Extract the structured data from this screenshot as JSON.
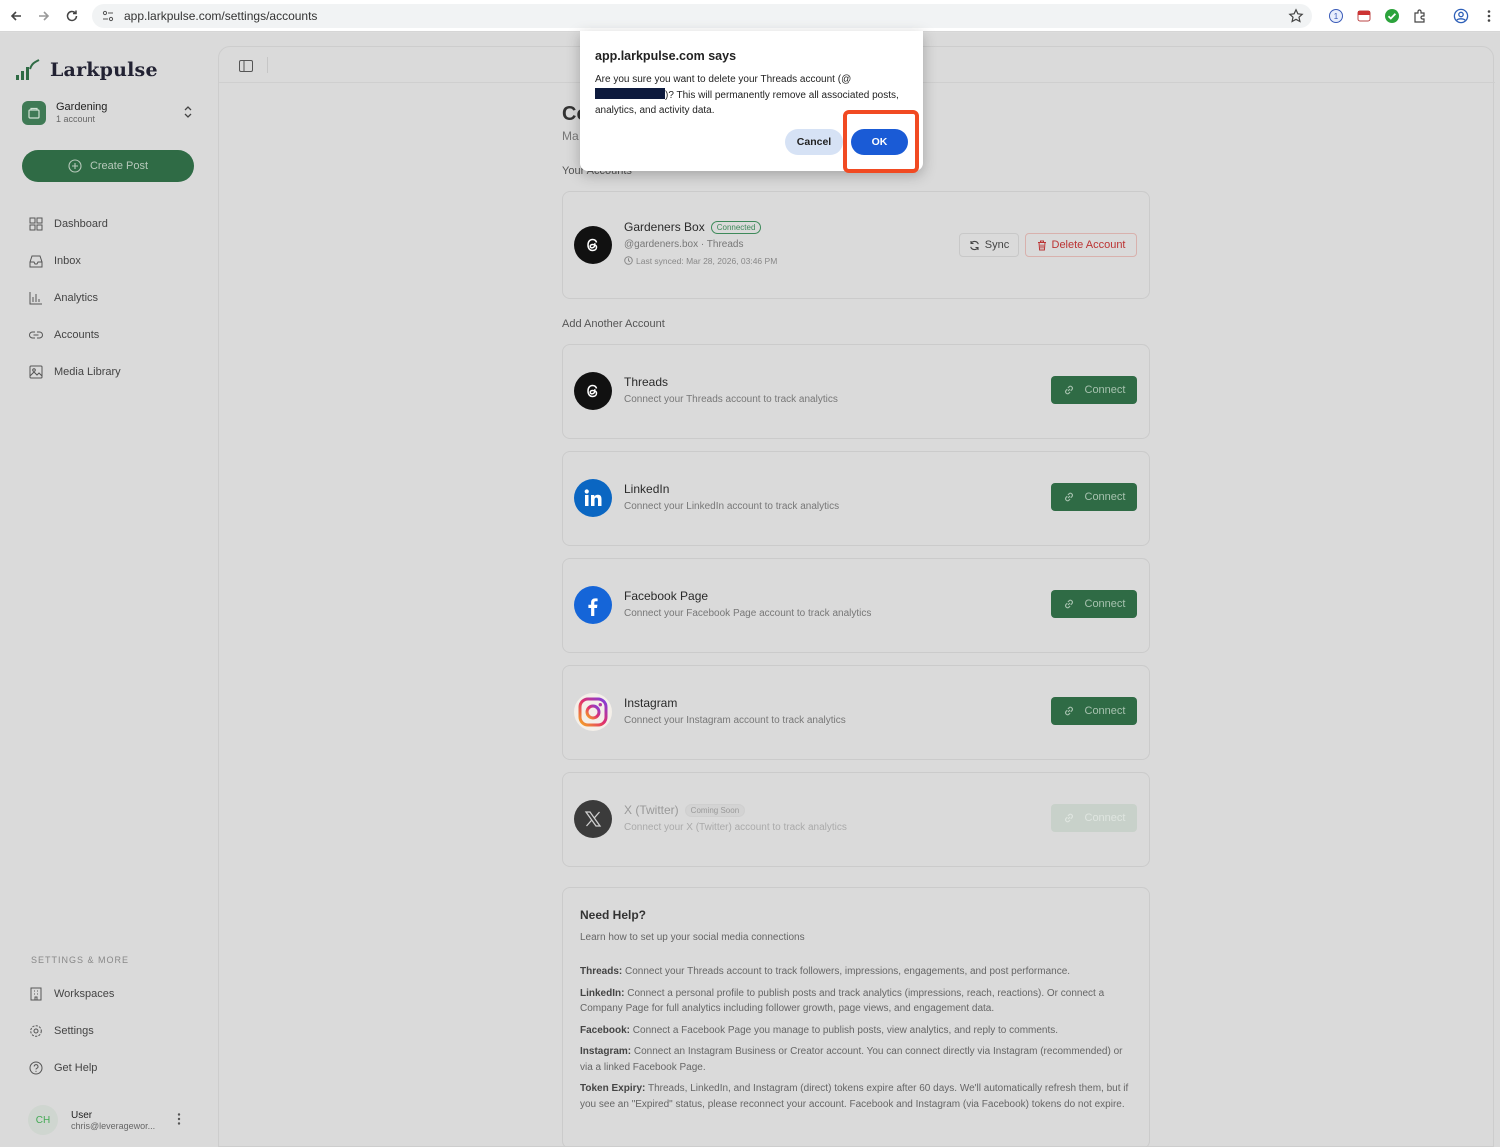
{
  "browser": {
    "url": "app.larkpulse.com/settings/accounts"
  },
  "sidebar": {
    "brand": "Larkpulse",
    "workspace": {
      "name": "Gardening",
      "sub": "1 account"
    },
    "create_label": "Create Post",
    "nav": [
      {
        "label": "Dashboard",
        "icon": "grid-icon"
      },
      {
        "label": "Inbox",
        "icon": "inbox-icon"
      },
      {
        "label": "Analytics",
        "icon": "bar-chart-icon"
      },
      {
        "label": "Accounts",
        "icon": "link-icon"
      },
      {
        "label": "Media Library",
        "icon": "image-icon"
      }
    ],
    "section_label": "SETTINGS & MORE",
    "nav2": [
      {
        "label": "Workspaces",
        "icon": "building-icon"
      },
      {
        "label": "Settings",
        "icon": "gear-icon"
      },
      {
        "label": "Get Help",
        "icon": "help-circle-icon"
      }
    ],
    "user": {
      "initials": "CH",
      "name": "User",
      "email": "chris@leveragewor..."
    }
  },
  "main": {
    "title_partial": "Co",
    "subtitle_partial": "Ma",
    "your_accounts_label": "Your Accounts",
    "connected_account": {
      "name": "Gardeners Box",
      "badge": "Connected",
      "handle": "@gardeners.box · Threads",
      "last_synced": "Last synced: Mar 28, 2026, 03:46 PM",
      "sync_label": "Sync",
      "delete_label": "Delete Account"
    },
    "add_label": "Add Another Account",
    "platforms": [
      {
        "name": "Threads",
        "desc": "Connect your Threads account to track analytics",
        "button": "Connect",
        "badge": ""
      },
      {
        "name": "LinkedIn",
        "desc": "Connect your LinkedIn account to track analytics",
        "button": "Connect",
        "badge": ""
      },
      {
        "name": "Facebook Page",
        "desc": "Connect your Facebook Page account to track analytics",
        "button": "Connect",
        "badge": ""
      },
      {
        "name": "Instagram",
        "desc": "Connect your Instagram account to track analytics",
        "button": "Connect",
        "badge": ""
      },
      {
        "name": "X (Twitter)",
        "desc": "Connect your X (Twitter) account to track analytics",
        "button": "Connect",
        "badge": "Coming Soon"
      }
    ],
    "help": {
      "title": "Need Help?",
      "subtitle": "Learn how to set up your social media connections",
      "items": [
        {
          "term": "Threads:",
          "text": " Connect your Threads account to track followers, impressions, engagements, and post performance."
        },
        {
          "term": "LinkedIn:",
          "text": " Connect a personal profile to publish posts and track analytics (impressions, reach, reactions). Or connect a Company Page for full analytics including follower growth, page views, and engagement data."
        },
        {
          "term": "Facebook:",
          "text": " Connect a Facebook Page you manage to publish posts, view analytics, and reply to comments."
        },
        {
          "term": "Instagram:",
          "text": " Connect an Instagram Business or Creator account. You can connect directly via Instagram (recommended) or via a linked Facebook Page."
        },
        {
          "term": "Token Expiry:",
          "text": " Threads, LinkedIn, and Instagram (direct) tokens expire after 60 days. We'll automatically refresh them, but if you see an \"Expired\" status, please reconnect your account. Facebook and Instagram (via Facebook) tokens do not expire."
        }
      ]
    }
  },
  "dialog": {
    "title": "app.larkpulse.com says",
    "msg_before": "Are you sure you want to delete your Threads account (@",
    "msg_after": ")? This will permanently remove all associated posts, analytics, and activity data.",
    "cancel_label": "Cancel",
    "ok_label": "OK"
  },
  "colors": {
    "brand_green": "#2f6b45",
    "ok_blue": "#1a5bd6",
    "highlight": "#f14a22",
    "danger": "#b33333"
  }
}
